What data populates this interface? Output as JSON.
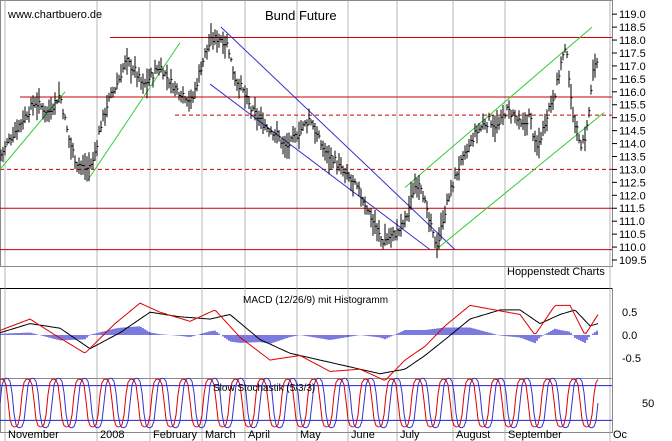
{
  "chart_data": [
    {
      "type": "line",
      "subtype": "ohlc-price",
      "title": "Bund Future",
      "watermark": "www.chartbuero.de",
      "source": "Hoppenstedt Charts",
      "y_axis": {
        "ticks": [
          109.5,
          110.0,
          110.5,
          111.0,
          111.5,
          112.0,
          112.5,
          113.0,
          113.5,
          114.0,
          114.5,
          115.0,
          115.5,
          116.0,
          116.5,
          117.0,
          117.5,
          118.0,
          118.5,
          119.0
        ],
        "tick_labels": [
          "109.5",
          "110.0",
          "110.5",
          "111.0",
          "111.5",
          "112.0",
          "112.5",
          "113.0",
          "113.5",
          "114.0",
          "114.5",
          "115.0",
          "115.5",
          "116.0",
          "116.5",
          "117.0",
          "117.5",
          "118.0",
          "118.5",
          "119.0"
        ],
        "ylim": [
          109.5,
          119.2
        ],
        "position": "right"
      },
      "x_axis": {
        "months": [
          "November",
          "2008",
          "February",
          "March",
          "April",
          "May",
          "June",
          "July",
          "August",
          "September",
          "Oc"
        ]
      },
      "horizontal_lines": [
        {
          "value": 118.1,
          "style": "solid",
          "x_start": 110
        },
        {
          "value": 115.8,
          "style": "solid",
          "x_start": 20
        },
        {
          "value": 115.1,
          "style": "dashed",
          "x_start": 175
        },
        {
          "value": 113.0,
          "style": "dashed",
          "x_start": 0
        },
        {
          "value": 111.5,
          "style": "solid",
          "x_start": 0
        },
        {
          "value": 109.9,
          "style": "solid",
          "x_start": 0
        }
      ],
      "trend_channels": [
        {
          "color": "#3333cc",
          "lines": [
            [
              [
                221,
                118.5
              ],
              [
                455,
                109.9
              ]
            ],
            [
              [
                210,
                116.3
              ],
              [
                430,
                109.9
              ]
            ]
          ]
        },
        {
          "color": "#33cc33",
          "lines": [
            [
              [
                0,
                113.0
              ],
              [
                65,
                116.0
              ]
            ],
            [
              [
                88,
                112.6
              ],
              [
                180,
                117.9
              ]
            ],
            [
              [
                405,
                112.3
              ],
              [
                592,
                118.5
              ]
            ],
            [
              [
                436,
                109.9
              ],
              [
                604,
                115.2
              ]
            ]
          ]
        }
      ],
      "anchors": [
        [
          0,
          113.5
        ],
        [
          10,
          114.2
        ],
        [
          22,
          114.9
        ],
        [
          35,
          115.6
        ],
        [
          48,
          115.2
        ],
        [
          60,
          115.9
        ],
        [
          68,
          114.3
        ],
        [
          76,
          113.3
        ],
        [
          86,
          113.0
        ],
        [
          93,
          113.3
        ],
        [
          100,
          114.6
        ],
        [
          108,
          115.6
        ],
        [
          118,
          116.4
        ],
        [
          126,
          117.2
        ],
        [
          135,
          116.8
        ],
        [
          143,
          116.2
        ],
        [
          151,
          116.6
        ],
        [
          160,
          117.0
        ],
        [
          168,
          116.5
        ],
        [
          176,
          116.1
        ],
        [
          184,
          115.9
        ],
        [
          192,
          115.6
        ],
        [
          199,
          116.7
        ],
        [
          206,
          117.6
        ],
        [
          212,
          118.0
        ],
        [
          220,
          118.1
        ],
        [
          228,
          117.8
        ],
        [
          234,
          116.6
        ],
        [
          242,
          116.1
        ],
        [
          251,
          115.3
        ],
        [
          260,
          114.9
        ],
        [
          268,
          114.6
        ],
        [
          276,
          114.4
        ],
        [
          286,
          113.8
        ],
        [
          294,
          114.2
        ],
        [
          302,
          114.6
        ],
        [
          310,
          115.0
        ],
        [
          318,
          114.2
        ],
        [
          326,
          113.6
        ],
        [
          334,
          113.4
        ],
        [
          342,
          112.9
        ],
        [
          350,
          112.6
        ],
        [
          358,
          112.2
        ],
        [
          366,
          111.6
        ],
        [
          374,
          110.9
        ],
        [
          382,
          110.2
        ],
        [
          390,
          110.4
        ],
        [
          398,
          110.6
        ],
        [
          406,
          111.1
        ],
        [
          414,
          112.3
        ],
        [
          420,
          112.6
        ],
        [
          427,
          111.3
        ],
        [
          434,
          110.3
        ],
        [
          438,
          110.1
        ],
        [
          443,
          111.1
        ],
        [
          450,
          112.1
        ],
        [
          458,
          113.0
        ],
        [
          466,
          113.6
        ],
        [
          474,
          114.3
        ],
        [
          482,
          114.7
        ],
        [
          490,
          114.9
        ],
        [
          498,
          114.6
        ],
        [
          506,
          115.3
        ],
        [
          514,
          115.1
        ],
        [
          522,
          114.6
        ],
        [
          530,
          115.1
        ],
        [
          536,
          113.7
        ],
        [
          542,
          114.4
        ],
        [
          548,
          115.3
        ],
        [
          556,
          116.1
        ],
        [
          562,
          117.3
        ],
        [
          567,
          117.6
        ],
        [
          571,
          115.6
        ],
        [
          576,
          114.6
        ],
        [
          581,
          114.0
        ],
        [
          586,
          114.3
        ],
        [
          590,
          115.6
        ],
        [
          594,
          117.1
        ],
        [
          598,
          117.2
        ]
      ]
    },
    {
      "type": "line",
      "title": "MACD (12/26/9) mit Histogramm",
      "y_axis": {
        "ticks": [
          0.5,
          0.0,
          -0.5
        ],
        "tick_labels": [
          "0.5",
          "0.0",
          "-0.5"
        ],
        "ylim": [
          -0.9,
          0.9
        ]
      },
      "series": [
        {
          "color": "#000000",
          "anchors": [
            [
              0,
              0.05
            ],
            [
              30,
              0.25
            ],
            [
              60,
              0.15
            ],
            [
              90,
              -0.3
            ],
            [
              120,
              0.05
            ],
            [
              150,
              0.5
            ],
            [
              180,
              0.4
            ],
            [
              210,
              0.35
            ],
            [
              230,
              0.45
            ],
            [
              260,
              -0.1
            ],
            [
              290,
              -0.4
            ],
            [
              320,
              -0.55
            ],
            [
              350,
              -0.7
            ],
            [
              380,
              -0.85
            ],
            [
              405,
              -0.75
            ],
            [
              425,
              -0.45
            ],
            [
              445,
              -0.1
            ],
            [
              470,
              0.35
            ],
            [
              500,
              0.55
            ],
            [
              520,
              0.55
            ],
            [
              540,
              0.25
            ],
            [
              560,
              0.45
            ],
            [
              575,
              0.55
            ],
            [
              590,
              0.2
            ],
            [
              598,
              0.25
            ]
          ]
        },
        {
          "color": "#dd0000",
          "anchors": [
            [
              0,
              0.1
            ],
            [
              30,
              0.35
            ],
            [
              55,
              0.0
            ],
            [
              85,
              -0.4
            ],
            [
              115,
              0.25
            ],
            [
              140,
              0.7
            ],
            [
              160,
              0.5
            ],
            [
              190,
              0.3
            ],
            [
              215,
              0.55
            ],
            [
              240,
              -0.05
            ],
            [
              270,
              -0.55
            ],
            [
              300,
              -0.45
            ],
            [
              330,
              -0.8
            ],
            [
              360,
              -0.75
            ],
            [
              385,
              -1.0
            ],
            [
              405,
              -0.55
            ],
            [
              425,
              -0.25
            ],
            [
              445,
              0.2
            ],
            [
              470,
              0.65
            ],
            [
              495,
              0.55
            ],
            [
              520,
              0.45
            ],
            [
              535,
              0.0
            ],
            [
              555,
              0.65
            ],
            [
              570,
              0.65
            ],
            [
              585,
              0.0
            ],
            [
              598,
              0.45
            ]
          ]
        }
      ],
      "histogram_color": "#2222cc"
    },
    {
      "type": "line",
      "title": "Slow Stochastik (5/3/3)",
      "y_axis": {
        "ticks": [
          50
        ],
        "tick_labels": [
          "50"
        ],
        "ylim": [
          0,
          100
        ],
        "reference_lines": [
          80,
          20
        ]
      },
      "series": [
        {
          "color": "#3333cc",
          "period": 26
        },
        {
          "color": "#dd0000",
          "period": 26
        }
      ]
    }
  ]
}
